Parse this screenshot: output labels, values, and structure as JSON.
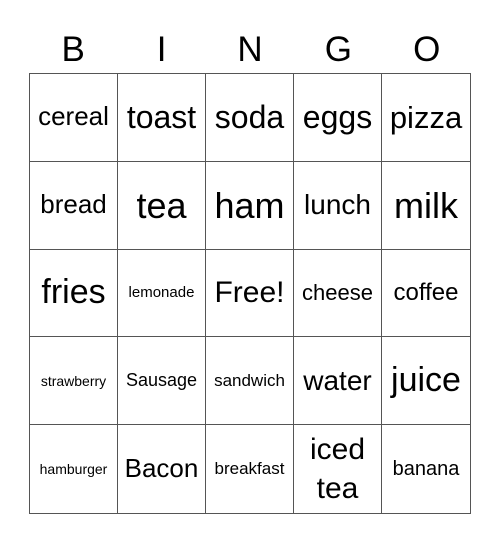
{
  "header": [
    "B",
    "I",
    "N",
    "G",
    "O"
  ],
  "cells": [
    {
      "text": "cereal",
      "size": 26
    },
    {
      "text": "toast",
      "size": 32
    },
    {
      "text": "soda",
      "size": 32
    },
    {
      "text": "eggs",
      "size": 32
    },
    {
      "text": "pizza",
      "size": 31
    },
    {
      "text": "bread",
      "size": 26
    },
    {
      "text": "tea",
      "size": 36
    },
    {
      "text": "ham",
      "size": 36
    },
    {
      "text": "lunch",
      "size": 28
    },
    {
      "text": "milk",
      "size": 36
    },
    {
      "text": "fries",
      "size": 34
    },
    {
      "text": "lemonade",
      "size": 15
    },
    {
      "text": "Free!",
      "size": 30
    },
    {
      "text": "cheese",
      "size": 22
    },
    {
      "text": "coffee",
      "size": 24
    },
    {
      "text": "strawberry",
      "size": 14
    },
    {
      "text": "Sausage",
      "size": 18
    },
    {
      "text": "sandwich",
      "size": 17
    },
    {
      "text": "water",
      "size": 28
    },
    {
      "text": "juice",
      "size": 34
    },
    {
      "text": "hamburger",
      "size": 14
    },
    {
      "text": "Bacon",
      "size": 26
    },
    {
      "text": "breakfast",
      "size": 17
    },
    {
      "text": "iced tea",
      "size": 30
    },
    {
      "text": "banana",
      "size": 20
    }
  ]
}
